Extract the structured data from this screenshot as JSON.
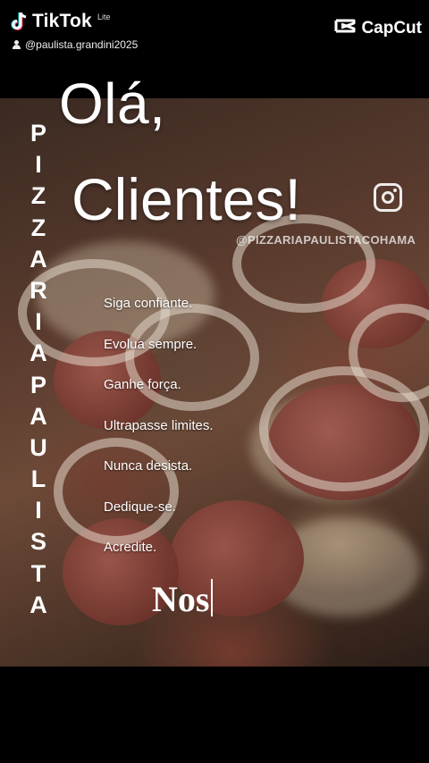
{
  "topbar": {
    "tiktok": {
      "word": "TikTok",
      "lite": "Lite",
      "username": "@paulista.grandini2025"
    },
    "capcut": {
      "word": "CapCut"
    }
  },
  "headline": {
    "line1": "Olá,",
    "line2": "Clientes!",
    "instagram_handle": "@PIZZARIAPAULISTACOHAMA"
  },
  "brand_vertical": [
    "P",
    "I",
    "Z",
    "Z",
    "A",
    "R",
    "I",
    "A",
    "P",
    "A",
    "U",
    "L",
    "I",
    "S",
    "T",
    "A"
  ],
  "motivations": [
    "Siga confiante.",
    "Evolua sempre.",
    "Ganhe força.",
    "Ultrapasse limites.",
    "Nunca desista.",
    "Dedique-se.",
    "Acredite."
  ],
  "typing_text": "Nos"
}
